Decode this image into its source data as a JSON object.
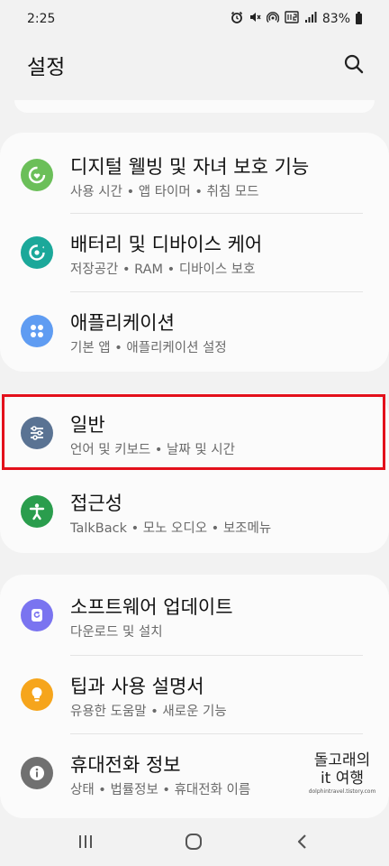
{
  "status_bar": {
    "time": "2:25",
    "battery": "83%",
    "icons": [
      "alarm-icon",
      "mute-icon",
      "hotspot-icon",
      "volte-icon",
      "signal-icon",
      "battery-icon"
    ]
  },
  "header": {
    "title": "설정",
    "search_icon": "search-icon"
  },
  "groups": [
    {
      "items": [
        {
          "title": "디지털 웰빙 및 자녀 보호 기능",
          "subtitle": "사용 시간  •  앱 타이머  •  취침 모드",
          "icon": "digital-wellbeing-icon",
          "color": "#6bbf59"
        },
        {
          "title": "배터리 및 디바이스 케어",
          "subtitle": "저장공간  •  RAM  •  디바이스 보호",
          "icon": "device-care-icon",
          "color": "#1ba89a"
        },
        {
          "title": "애플리케이션",
          "subtitle": "기본 앱  •  애플리케이션 설정",
          "icon": "apps-icon",
          "color": "#5f9cf2"
        }
      ]
    },
    {
      "items": [
        {
          "title": "일반",
          "subtitle": "언어 및 키보드  •  날짜 및 시간",
          "icon": "general-management-icon",
          "color": "#5a7393"
        },
        {
          "title": "접근성",
          "subtitle": "TalkBack  •  모노 오디오  •  보조메뉴",
          "icon": "accessibility-icon",
          "color": "#2a9d4d"
        }
      ]
    },
    {
      "items": [
        {
          "title": "소프트웨어 업데이트",
          "subtitle": "다운로드 및 설치",
          "icon": "software-update-icon",
          "color": "#7a74f0"
        },
        {
          "title": "팁과 사용 설명서",
          "subtitle": "유용한 도움말  •  새로운 기능",
          "icon": "tips-icon",
          "color": "#f6a51c"
        },
        {
          "title": "휴대전화 정보",
          "subtitle": "상태  •  법률정보  •  휴대전화 이름",
          "icon": "about-phone-icon",
          "color": "#707070"
        }
      ]
    }
  ],
  "highlight_color": "#e3101b",
  "watermark": {
    "line1": "돌고래의",
    "line2": "it 여행",
    "url": "dolphintravel.tistory.com"
  },
  "nav_bar": {
    "icons": [
      "recent-apps-icon",
      "home-icon",
      "back-icon"
    ]
  }
}
